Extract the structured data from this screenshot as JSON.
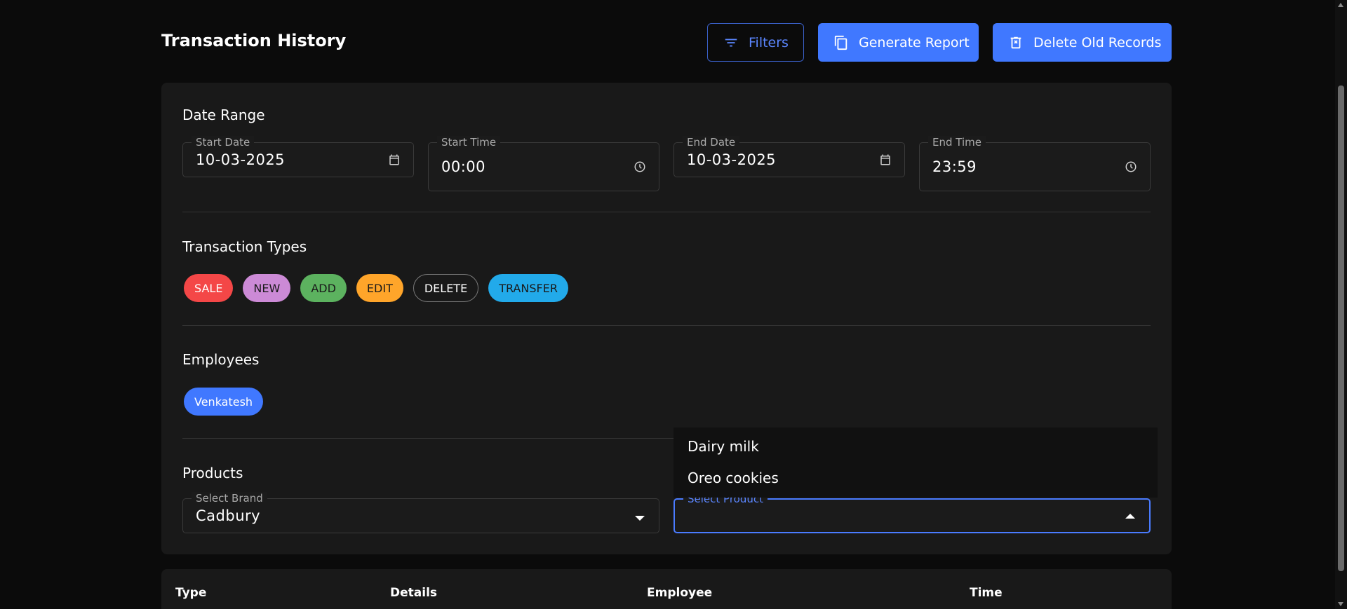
{
  "header": {
    "title": "Transaction History",
    "filters_label": "Filters",
    "report_label": "Generate Report",
    "delete_label": "Delete Old Records"
  },
  "filters": {
    "date_range": {
      "title": "Date Range",
      "start_date": {
        "label": "Start Date",
        "value": "10-03-2025",
        "icon": "calendar-icon"
      },
      "start_time": {
        "label": "Start Time",
        "value": "00:00",
        "icon": "clock-icon"
      },
      "end_date": {
        "label": "End Date",
        "value": "10-03-2025",
        "icon": "calendar-icon"
      },
      "end_time": {
        "label": "End Time",
        "value": "23:59",
        "icon": "clock-icon"
      }
    },
    "transaction_types": {
      "title": "Transaction Types",
      "items": [
        "SALE",
        "NEW",
        "ADD",
        "EDIT",
        "DELETE",
        "TRANSFER"
      ],
      "colors": [
        "#f44747",
        "#cc8ad6",
        "#5cb25f",
        "#ffa52a",
        "transparent",
        "#22aaea"
      ]
    },
    "employees": {
      "title": "Employees",
      "items": [
        "Venkatesh"
      ]
    },
    "products": {
      "title": "Products",
      "brand": {
        "label": "Select Brand",
        "value": "Cadbury"
      },
      "product": {
        "label": "Select Product",
        "value": "",
        "open": true
      },
      "options": [
        "Dairy milk",
        "Oreo cookies"
      ]
    }
  },
  "table": {
    "columns": [
      "Type",
      "Details",
      "Employee",
      "Time"
    ]
  },
  "colors": {
    "background": "#0b0b0b",
    "panel": "#191919",
    "accent": "#4078ff"
  }
}
